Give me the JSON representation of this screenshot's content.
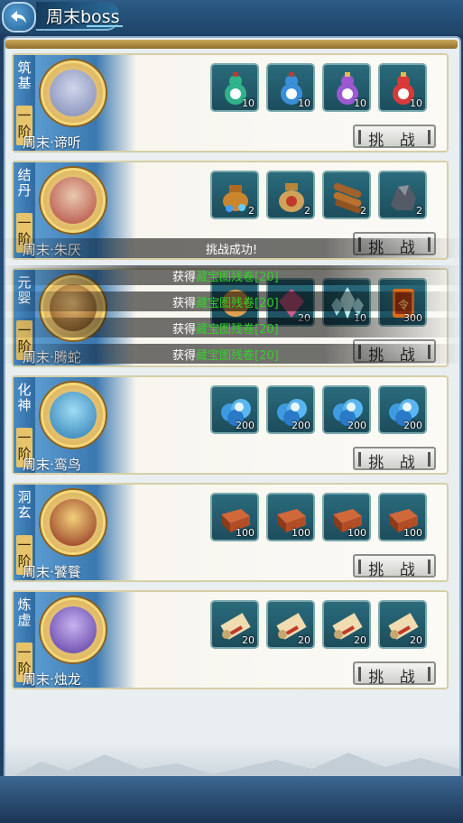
{
  "header": {
    "title": "周末boss"
  },
  "bosses": [
    {
      "rank": "筑基",
      "rank_tab": "一阶",
      "name": "周末·谛听",
      "challenge": "挑 战",
      "rewards": [
        {
          "icon": "green-gourd-icon",
          "count": "10"
        },
        {
          "icon": "blue-gourd-icon",
          "count": "10"
        },
        {
          "icon": "purple-gourd-icon",
          "count": "10"
        },
        {
          "icon": "red-gourd-icon",
          "count": "10"
        }
      ]
    },
    {
      "rank": "结丹",
      "rank_tab": "一阶",
      "name": "周末·朱厌",
      "challenge": "挑 战",
      "rewards": [
        {
          "icon": "gem-bag-icon",
          "count": "2"
        },
        {
          "icon": "money-bag-icon",
          "count": "2"
        },
        {
          "icon": "wood-logs-icon",
          "count": "2"
        },
        {
          "icon": "iron-ore-icon",
          "count": "2"
        }
      ]
    },
    {
      "rank": "元婴",
      "rank_tab": "一阶",
      "name": "周末·腾蛇",
      "challenge": "挑 战",
      "rewards": [
        {
          "icon": "orb-icon",
          "count": ""
        },
        {
          "icon": "pink-crystal-icon",
          "count": "20"
        },
        {
          "icon": "ice-crystal-icon",
          "count": "10"
        },
        {
          "icon": "token-icon",
          "count": "300"
        }
      ]
    },
    {
      "rank": "化神",
      "rank_tab": "一阶",
      "name": "周末·鸾鸟",
      "challenge": "挑 战",
      "rewards": [
        {
          "icon": "cloud-icon",
          "count": "200"
        },
        {
          "icon": "cloud-icon",
          "count": "200"
        },
        {
          "icon": "cloud-icon",
          "count": "200"
        },
        {
          "icon": "cloud-icon",
          "count": "200"
        }
      ]
    },
    {
      "rank": "洞玄",
      "rank_tab": "一阶",
      "name": "周末·饕餮",
      "challenge": "挑 战",
      "rewards": [
        {
          "icon": "brick-icon",
          "count": "100"
        },
        {
          "icon": "brick-icon",
          "count": "100"
        },
        {
          "icon": "brick-icon",
          "count": "100"
        },
        {
          "icon": "brick-icon",
          "count": "100"
        }
      ]
    },
    {
      "rank": "炼虚",
      "rank_tab": "一阶",
      "name": "周末·烛龙",
      "challenge": "挑 战",
      "rewards": [
        {
          "icon": "scroll-icon",
          "count": "20"
        },
        {
          "icon": "scroll-icon",
          "count": "20"
        },
        {
          "icon": "scroll-icon",
          "count": "20"
        },
        {
          "icon": "scroll-icon",
          "count": "20"
        }
      ]
    }
  ],
  "toast": {
    "success": "挑战成功!",
    "messages": [
      {
        "prefix": "获得",
        "item": "藏宝图残卷",
        "count": "[20]"
      },
      {
        "prefix": "获得",
        "item": "藏宝图残卷",
        "count": "[20]"
      },
      {
        "prefix": "获得",
        "item": "藏宝图残卷",
        "count": "[20]"
      },
      {
        "prefix": "获得",
        "item": "藏宝图残卷",
        "count": "[20]"
      }
    ]
  },
  "colors": {
    "accent": "#3a78b0",
    "reward_green": "#34d12a",
    "frame_gold": "#e7c36a"
  }
}
